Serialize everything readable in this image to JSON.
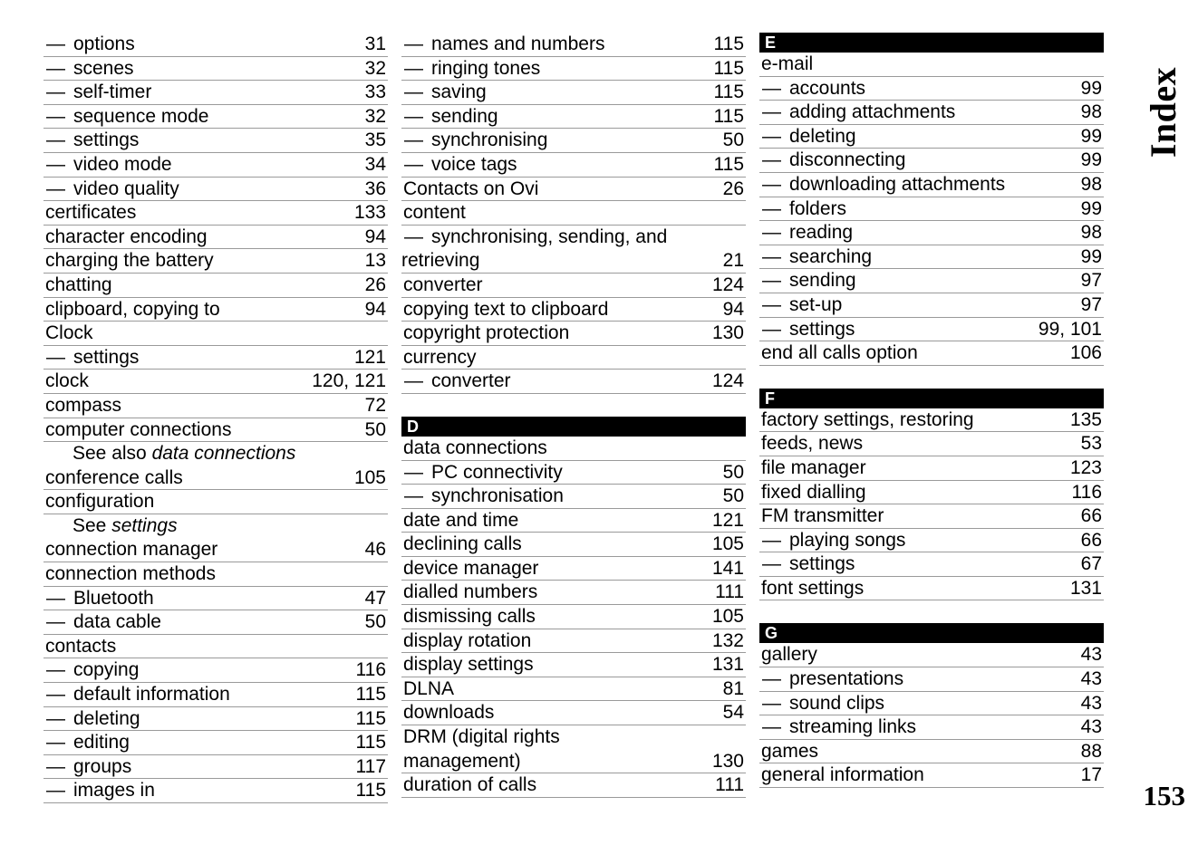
{
  "page": {
    "side_title": "Index",
    "folio": "153"
  },
  "columns": [
    {
      "id": "column-1",
      "sections": [
        {
          "letter": null,
          "entries": [
            {
              "type": "sub",
              "label": "options",
              "page": "31"
            },
            {
              "type": "sub",
              "label": "scenes",
              "page": "32"
            },
            {
              "type": "sub",
              "label": "self-timer",
              "page": "33"
            },
            {
              "type": "sub",
              "label": "sequence mode",
              "page": "32"
            },
            {
              "type": "sub",
              "label": "settings",
              "page": "35"
            },
            {
              "type": "sub",
              "label": "video mode",
              "page": "34"
            },
            {
              "type": "sub",
              "label": "video quality",
              "page": "36"
            },
            {
              "type": "main",
              "label": "certificates",
              "page": "133"
            },
            {
              "type": "main",
              "label": "character encoding",
              "page": "94"
            },
            {
              "type": "main",
              "label": "charging the battery",
              "page": "13"
            },
            {
              "type": "main",
              "label": "chatting",
              "page": "26"
            },
            {
              "type": "main",
              "label": "clipboard, copying to",
              "page": "94"
            },
            {
              "type": "main",
              "label": "Clock",
              "page": ""
            },
            {
              "type": "sub",
              "label": "settings",
              "page": "121"
            },
            {
              "type": "main",
              "label": "clock",
              "page": "120, 121"
            },
            {
              "type": "main",
              "label": "compass",
              "page": "72"
            },
            {
              "type": "main",
              "label": "computer connections",
              "page": "50"
            },
            {
              "type": "xref",
              "prefix": "See also ",
              "target": "data connections"
            },
            {
              "type": "main",
              "label": "conference calls",
              "page": "105"
            },
            {
              "type": "main",
              "label": "configuration",
              "page": ""
            },
            {
              "type": "xref",
              "prefix": "See ",
              "target": "settings"
            },
            {
              "type": "main",
              "label": "connection manager",
              "page": "46"
            },
            {
              "type": "main",
              "label": "connection methods",
              "page": ""
            },
            {
              "type": "sub",
              "label": "Bluetooth",
              "page": "47"
            },
            {
              "type": "sub",
              "label": "data cable",
              "page": "50"
            },
            {
              "type": "main",
              "label": "contacts",
              "page": ""
            },
            {
              "type": "sub",
              "label": "copying",
              "page": "116"
            },
            {
              "type": "sub",
              "label": "default information",
              "page": "115"
            },
            {
              "type": "sub",
              "label": "deleting",
              "page": "115"
            },
            {
              "type": "sub",
              "label": "editing",
              "page": "115"
            },
            {
              "type": "sub",
              "label": "groups",
              "page": "117"
            },
            {
              "type": "sub",
              "label": "images in",
              "page": "115"
            }
          ]
        }
      ]
    },
    {
      "id": "column-2",
      "sections": [
        {
          "letter": null,
          "entries": [
            {
              "type": "sub",
              "label": "names and numbers",
              "page": "115"
            },
            {
              "type": "sub",
              "label": "ringing tones",
              "page": "115"
            },
            {
              "type": "sub",
              "label": "saving",
              "page": "115"
            },
            {
              "type": "sub",
              "label": "sending",
              "page": "115"
            },
            {
              "type": "sub",
              "label": "synchronising",
              "page": "50"
            },
            {
              "type": "sub",
              "label": "voice tags",
              "page": "115"
            },
            {
              "type": "main",
              "label": "Contacts on Ovi",
              "page": "26"
            },
            {
              "type": "main",
              "label": "content",
              "page": ""
            },
            {
              "type": "sub-wrap",
              "label": "synchronising, sending, and",
              "label2": "retrieving",
              "page": "21"
            },
            {
              "type": "main",
              "label": "converter",
              "page": "124"
            },
            {
              "type": "main",
              "label": "copying text to clipboard",
              "page": "94"
            },
            {
              "type": "main",
              "label": "copyright protection",
              "page": "130"
            },
            {
              "type": "main",
              "label": "currency",
              "page": ""
            },
            {
              "type": "sub",
              "label": "converter",
              "page": "124"
            }
          ]
        },
        {
          "letter": "D",
          "gap": true,
          "entries": [
            {
              "type": "main",
              "label": "data connections",
              "page": ""
            },
            {
              "type": "sub",
              "label": "PC connectivity",
              "page": "50"
            },
            {
              "type": "sub",
              "label": "synchronisation",
              "page": "50"
            },
            {
              "type": "main",
              "label": "date and time",
              "page": "121"
            },
            {
              "type": "main",
              "label": "declining calls",
              "page": "105"
            },
            {
              "type": "main",
              "label": "device manager",
              "page": "141"
            },
            {
              "type": "main",
              "label": "dialled numbers",
              "page": "111"
            },
            {
              "type": "main",
              "label": "dismissing calls",
              "page": "105"
            },
            {
              "type": "main",
              "label": "display rotation",
              "page": "132"
            },
            {
              "type": "main",
              "label": "display settings",
              "page": "131"
            },
            {
              "type": "main",
              "label": "DLNA",
              "page": "81"
            },
            {
              "type": "main",
              "label": "downloads",
              "page": "54"
            },
            {
              "type": "main-wrap",
              "label": "DRM (digital rights",
              "label2": "management)",
              "page": "130"
            },
            {
              "type": "main",
              "label": "duration of calls",
              "page": "111"
            }
          ]
        }
      ]
    },
    {
      "id": "column-3",
      "sections": [
        {
          "letter": "E",
          "entries": [
            {
              "type": "main",
              "label": "e-mail",
              "page": ""
            },
            {
              "type": "sub",
              "label": "accounts",
              "page": "99"
            },
            {
              "type": "sub",
              "label": "adding attachments",
              "page": "98"
            },
            {
              "type": "sub",
              "label": "deleting",
              "page": "99"
            },
            {
              "type": "sub",
              "label": "disconnecting",
              "page": "99"
            },
            {
              "type": "sub",
              "label": "downloading attachments",
              "page": "98"
            },
            {
              "type": "sub",
              "label": "folders",
              "page": "99"
            },
            {
              "type": "sub",
              "label": "reading",
              "page": "98"
            },
            {
              "type": "sub",
              "label": "searching",
              "page": "99"
            },
            {
              "type": "sub",
              "label": "sending",
              "page": "97"
            },
            {
              "type": "sub",
              "label": "set-up",
              "page": "97"
            },
            {
              "type": "sub",
              "label": "settings",
              "page": "99, 101"
            },
            {
              "type": "main",
              "label": "end all calls option",
              "page": "106"
            }
          ]
        },
        {
          "letter": "F",
          "gap": true,
          "entries": [
            {
              "type": "main",
              "label": "factory settings, restoring",
              "page": "135"
            },
            {
              "type": "main",
              "label": "feeds, news",
              "page": "53"
            },
            {
              "type": "main",
              "label": "file manager",
              "page": "123"
            },
            {
              "type": "main",
              "label": "fixed dialling",
              "page": "116"
            },
            {
              "type": "main",
              "label": "FM transmitter",
              "page": "66"
            },
            {
              "type": "sub",
              "label": "playing songs",
              "page": "66"
            },
            {
              "type": "sub",
              "label": "settings",
              "page": "67"
            },
            {
              "type": "main",
              "label": "font settings",
              "page": "131"
            }
          ]
        },
        {
          "letter": "G",
          "gap": true,
          "entries": [
            {
              "type": "main",
              "label": "gallery",
              "page": "43"
            },
            {
              "type": "sub",
              "label": "presentations",
              "page": "43"
            },
            {
              "type": "sub",
              "label": "sound clips",
              "page": "43"
            },
            {
              "type": "sub",
              "label": "streaming links",
              "page": "43"
            },
            {
              "type": "main",
              "label": "games",
              "page": "88"
            },
            {
              "type": "main",
              "label": "general information",
              "page": "17"
            }
          ]
        }
      ]
    }
  ],
  "icons": {
    "em_dash": "—"
  }
}
